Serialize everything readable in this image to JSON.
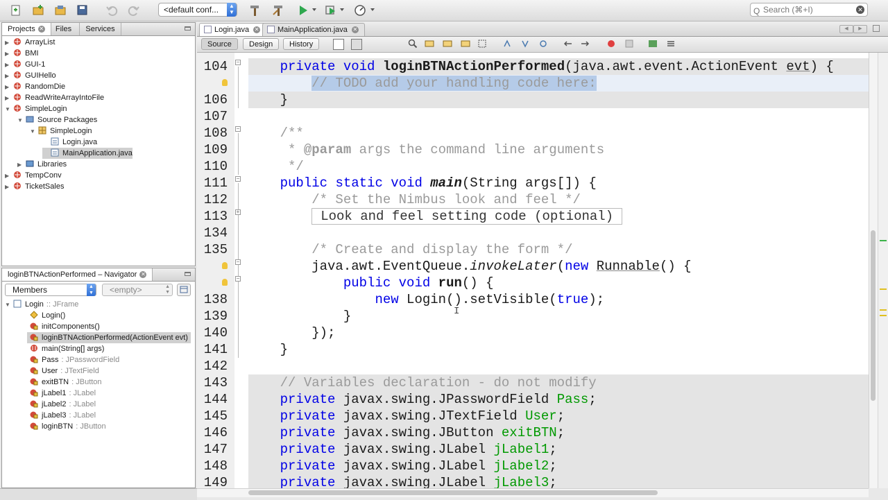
{
  "toolbar": {
    "config": "<default conf...",
    "search_placeholder": "Search (⌘+I)",
    "search_icon": "Q"
  },
  "projects_panel": {
    "tabs": [
      "Projects",
      "Files",
      "Services"
    ],
    "items": [
      {
        "label": "ArrayList",
        "depth": 0,
        "icon": "project-icon"
      },
      {
        "label": "BMI",
        "depth": 0,
        "icon": "project-icon"
      },
      {
        "label": "GUI-1",
        "depth": 0,
        "icon": "project-icon"
      },
      {
        "label": "GUIHello",
        "depth": 0,
        "icon": "project-icon"
      },
      {
        "label": "RandomDie",
        "depth": 0,
        "icon": "project-icon"
      },
      {
        "label": "ReadWriteArrayIntoFile",
        "depth": 0,
        "icon": "project-icon"
      },
      {
        "label": "SimpleLogin",
        "depth": 0,
        "icon": "project-icon"
      },
      {
        "label": "Source Packages",
        "depth": 1,
        "icon": "source-packages-icon"
      },
      {
        "label": "SimpleLogin",
        "depth": 2,
        "icon": "package-icon"
      },
      {
        "label": "Login.java",
        "depth": 3,
        "icon": "java-form-icon"
      },
      {
        "label": "MainApplication.java",
        "depth": 3,
        "icon": "java-file-icon"
      },
      {
        "label": "Libraries",
        "depth": 1,
        "icon": "libraries-icon"
      },
      {
        "label": "TempConv",
        "depth": 0,
        "icon": "project-icon"
      },
      {
        "label": "TicketSales",
        "depth": 0,
        "icon": "project-icon"
      }
    ]
  },
  "navigator": {
    "title": "loginBTNActionPerformed – Navigator",
    "filter": "Members",
    "scope": "<empty>",
    "members": [
      {
        "name": "Login",
        "type": ":: JFrame"
      },
      {
        "name": "Login()",
        "type": ""
      },
      {
        "name": "initComponents()",
        "type": ""
      },
      {
        "name": "loginBTNActionPerformed(ActionEvent evt)",
        "type": ""
      },
      {
        "name": "main(String[] args)",
        "type": ""
      },
      {
        "name": "Pass",
        "type": ": JPasswordField"
      },
      {
        "name": "User",
        "type": ": JTextField"
      },
      {
        "name": "exitBTN",
        "type": ": JButton"
      },
      {
        "name": "jLabel1",
        "type": ": JLabel"
      },
      {
        "name": "jLabel2",
        "type": ": JLabel"
      },
      {
        "name": "jLabel3",
        "type": ": JLabel"
      },
      {
        "name": "loginBTN",
        "type": ": JButton"
      }
    ]
  },
  "editor": {
    "tabs": [
      "Login.java",
      "MainApplication.java"
    ],
    "view_tabs": [
      "Source",
      "Design",
      "History"
    ],
    "lines": [
      {
        "n": "104",
        "tokens": [
          [
            "    ",
            ""
          ],
          [
            "private",
            "kw"
          ],
          [
            " ",
            ""
          ],
          [
            "void",
            "kw"
          ],
          [
            " ",
            ""
          ],
          [
            "loginBTNActionPerformed",
            "b"
          ],
          [
            "(java.awt.event.ActionEvent ",
            ""
          ],
          [
            "evt",
            "ul"
          ],
          [
            ") {",
            ""
          ]
        ]
      },
      {
        "n": "",
        "tokens": [
          [
            "        ",
            ""
          ],
          [
            "// TODO add your handling code here:",
            "cm sel-txt"
          ]
        ]
      },
      {
        "n": "106",
        "tokens": [
          [
            "    }",
            ""
          ]
        ]
      },
      {
        "n": "107",
        "tokens": []
      },
      {
        "n": "108",
        "tokens": [
          [
            "    ",
            ""
          ],
          [
            "/**",
            "cm"
          ]
        ]
      },
      {
        "n": "109",
        "tokens": [
          [
            "     ",
            ""
          ],
          [
            "* ",
            "cm"
          ],
          [
            "@param",
            "cm b"
          ],
          [
            " ",
            ""
          ],
          [
            "args",
            "cm"
          ],
          [
            " the command line arguments",
            "cm"
          ]
        ]
      },
      {
        "n": "110",
        "tokens": [
          [
            "     ",
            ""
          ],
          [
            "*/",
            "cm"
          ]
        ]
      },
      {
        "n": "111",
        "tokens": [
          [
            "    ",
            ""
          ],
          [
            "public",
            "kw"
          ],
          [
            " ",
            ""
          ],
          [
            "static",
            "kw"
          ],
          [
            " ",
            ""
          ],
          [
            "void",
            "kw"
          ],
          [
            " ",
            ""
          ],
          [
            "main",
            "bi"
          ],
          [
            "(String args[]) {",
            ""
          ]
        ]
      },
      {
        "n": "112",
        "tokens": [
          [
            "        ",
            ""
          ],
          [
            "/* Set the Nimbus look and feel */",
            "cm"
          ]
        ]
      },
      {
        "n": "113",
        "tokens": [
          [
            "        ",
            ""
          ],
          [
            "Look and feel setting code (optional)",
            "folded"
          ]
        ]
      },
      {
        "n": "134",
        "tokens": []
      },
      {
        "n": "135",
        "tokens": [
          [
            "        ",
            ""
          ],
          [
            "/* Create and display the form */",
            "cm"
          ]
        ]
      },
      {
        "n": "",
        "tokens": [
          [
            "        java.awt.EventQueue.",
            ""
          ],
          [
            "invokeLater",
            "it"
          ],
          [
            "(",
            ""
          ],
          [
            "new",
            "kw"
          ],
          [
            " ",
            ""
          ],
          [
            "Runnable",
            "ul"
          ],
          [
            "() {",
            ""
          ]
        ]
      },
      {
        "n": "",
        "tokens": [
          [
            "            ",
            ""
          ],
          [
            "public",
            "kw"
          ],
          [
            " ",
            ""
          ],
          [
            "void",
            "kw"
          ],
          [
            " ",
            ""
          ],
          [
            "run",
            "b"
          ],
          [
            "() {",
            ""
          ]
        ]
      },
      {
        "n": "138",
        "tokens": [
          [
            "                ",
            ""
          ],
          [
            "new",
            "kw"
          ],
          [
            " Login().setVisible(",
            ""
          ],
          [
            "true",
            "kw"
          ],
          [
            ");",
            ""
          ]
        ]
      },
      {
        "n": "139",
        "tokens": [
          [
            "            }",
            ""
          ]
        ]
      },
      {
        "n": "140",
        "tokens": [
          [
            "        });",
            ""
          ]
        ]
      },
      {
        "n": "141",
        "tokens": [
          [
            "    }",
            ""
          ]
        ]
      },
      {
        "n": "142",
        "tokens": []
      },
      {
        "n": "143",
        "tokens": [
          [
            "    ",
            ""
          ],
          [
            "// Variables declaration - do not modify",
            "cm"
          ]
        ]
      },
      {
        "n": "144",
        "tokens": [
          [
            "    ",
            ""
          ],
          [
            "private",
            "kw"
          ],
          [
            " javax.swing.JPasswordField ",
            ""
          ],
          [
            "Pass",
            "fld"
          ],
          [
            ";",
            ""
          ]
        ]
      },
      {
        "n": "145",
        "tokens": [
          [
            "    ",
            ""
          ],
          [
            "private",
            "kw"
          ],
          [
            " javax.swing.JTextField ",
            ""
          ],
          [
            "User",
            "fld"
          ],
          [
            ";",
            ""
          ]
        ]
      },
      {
        "n": "146",
        "tokens": [
          [
            "    ",
            ""
          ],
          [
            "private",
            "kw"
          ],
          [
            " javax.swing.JButton ",
            ""
          ],
          [
            "exitBTN",
            "fld"
          ],
          [
            ";",
            ""
          ]
        ]
      },
      {
        "n": "147",
        "tokens": [
          [
            "    ",
            ""
          ],
          [
            "private",
            "kw"
          ],
          [
            " javax.swing.JLabel ",
            ""
          ],
          [
            "jLabel1",
            "fld"
          ],
          [
            ";",
            ""
          ]
        ]
      },
      {
        "n": "148",
        "tokens": [
          [
            "    ",
            ""
          ],
          [
            "private",
            "kw"
          ],
          [
            " javax.swing.JLabel ",
            ""
          ],
          [
            "jLabel2",
            "fld"
          ],
          [
            ";",
            ""
          ]
        ]
      },
      {
        "n": "149",
        "tokens": [
          [
            "    ",
            ""
          ],
          [
            "private",
            "kw"
          ],
          [
            " javax.swing.JLabel ",
            ""
          ],
          [
            "jLabel3",
            "fld"
          ],
          [
            ";",
            ""
          ]
        ]
      }
    ]
  }
}
